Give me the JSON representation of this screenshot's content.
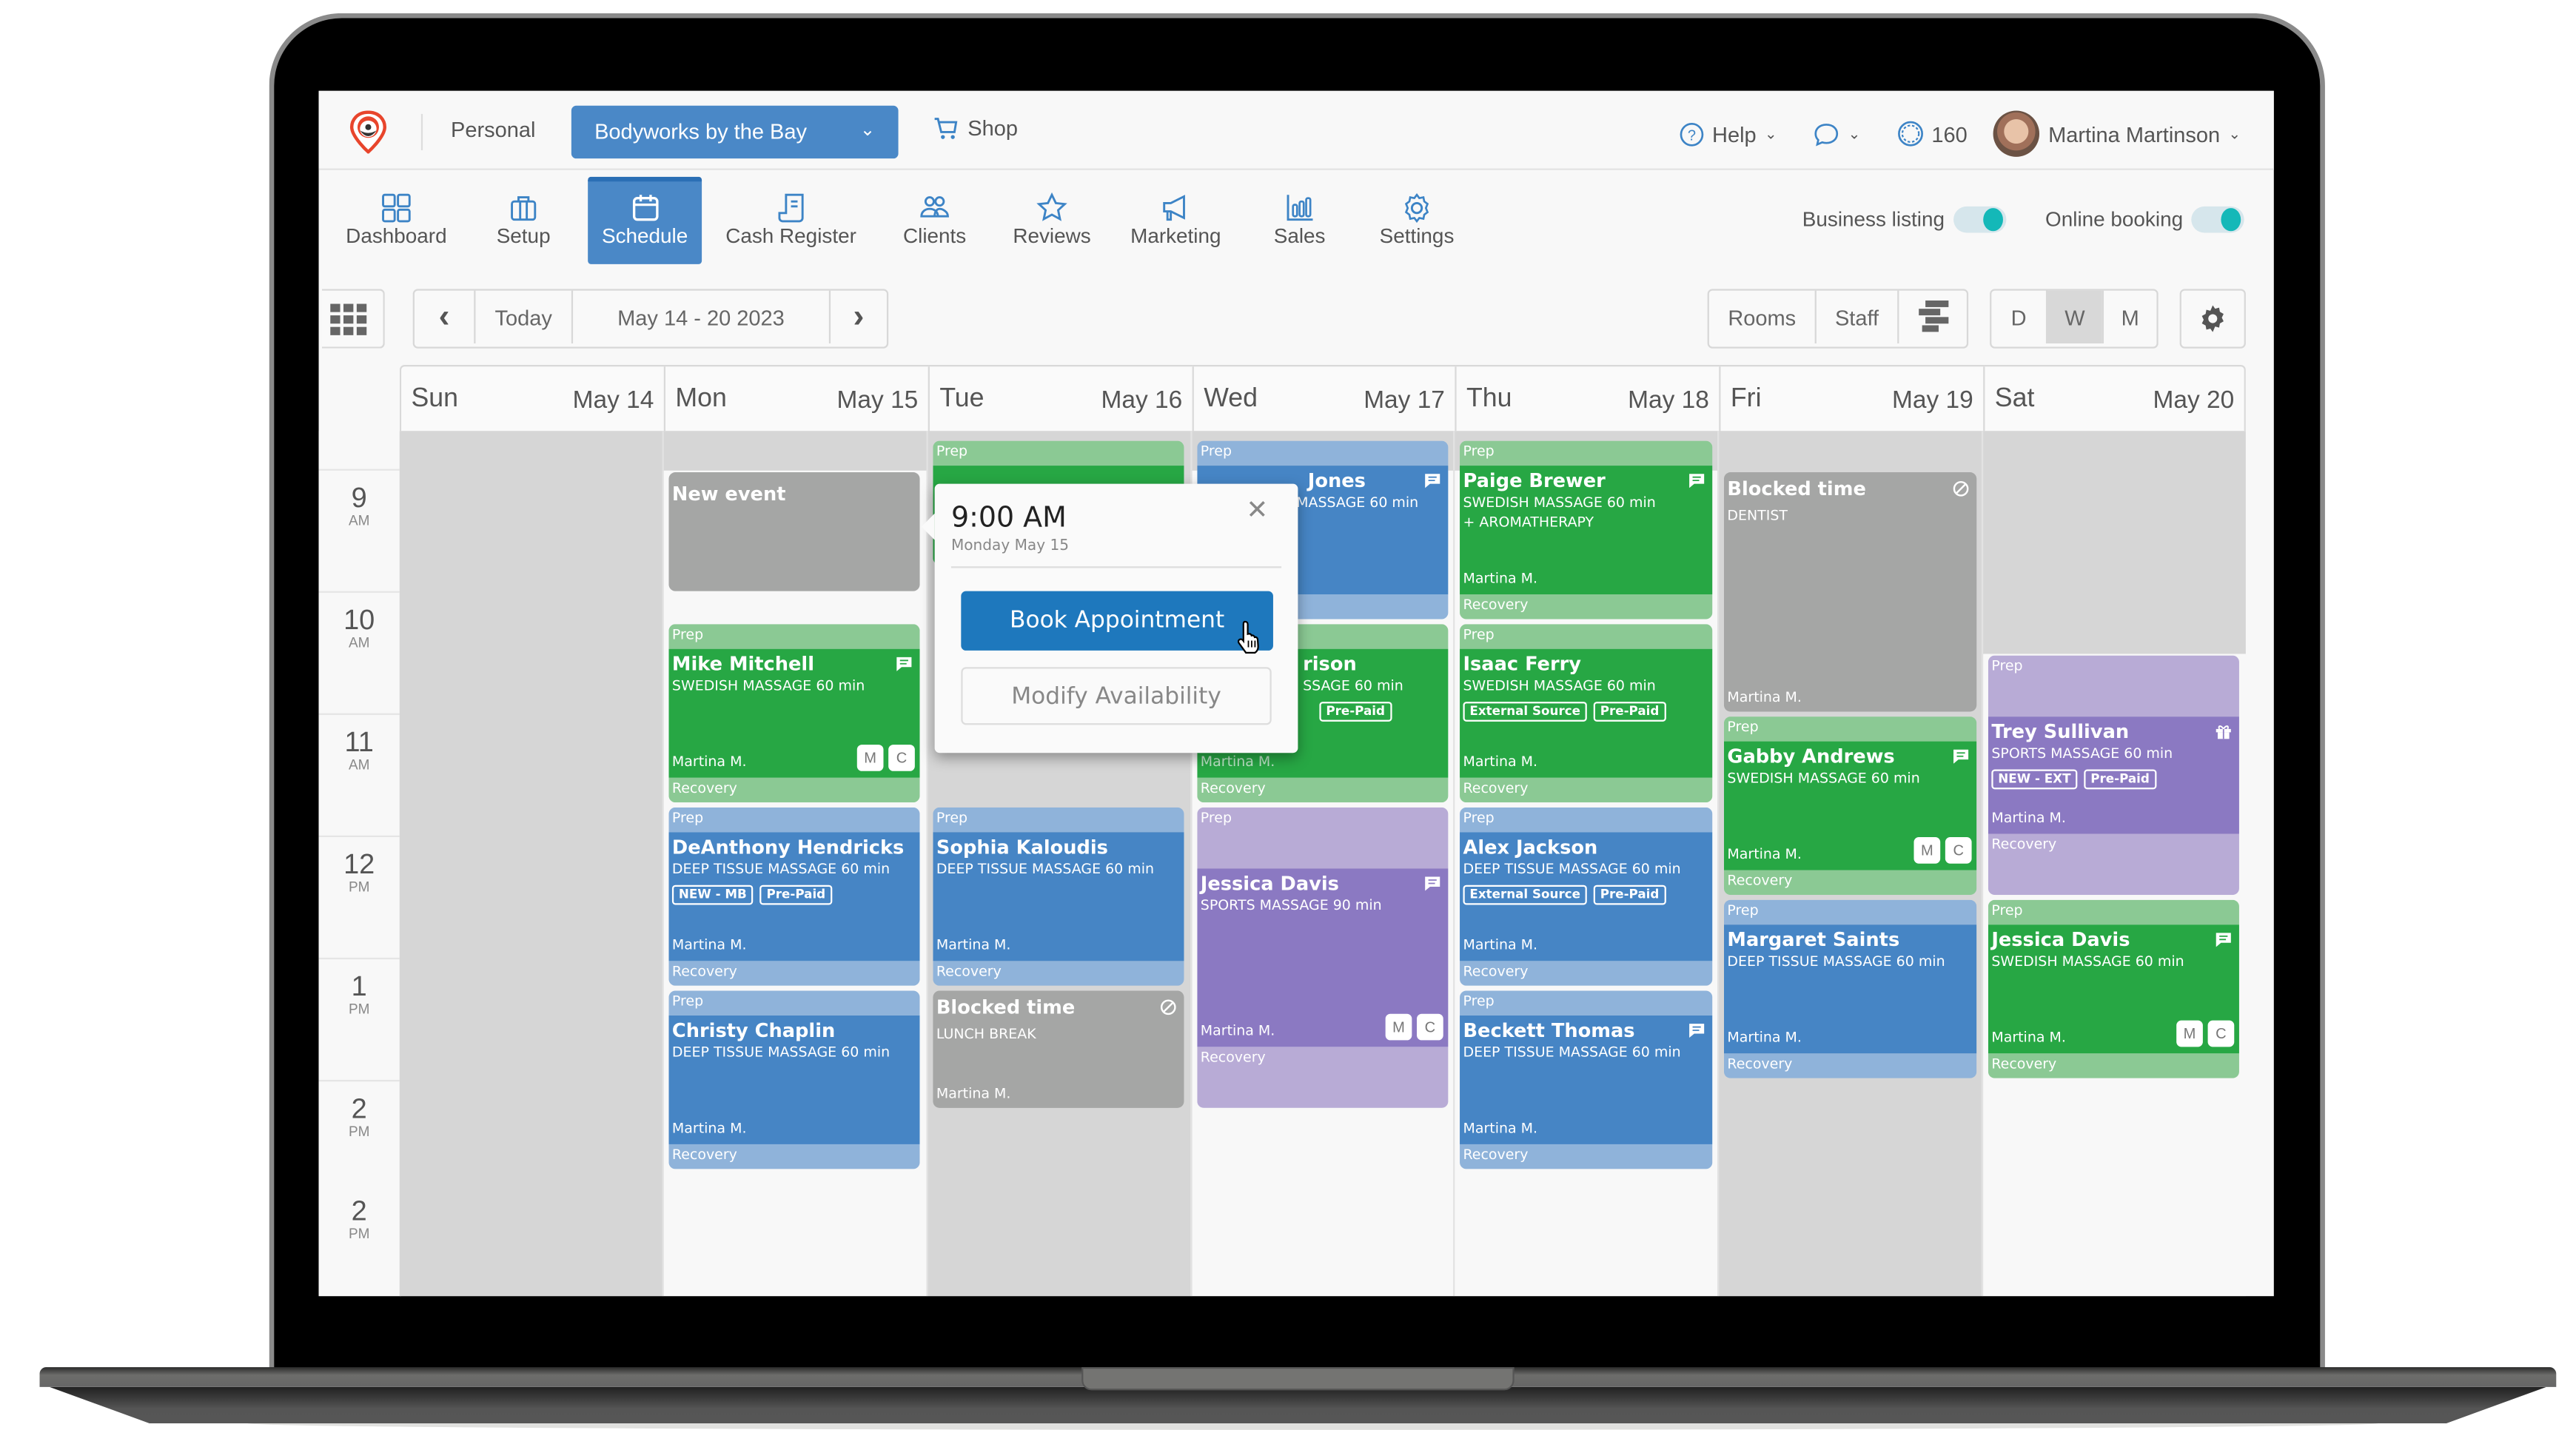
{
  "header": {
    "personal_label": "Personal",
    "business_select": "Bodyworks by the Bay",
    "shop_label": "Shop",
    "help_label": "Help",
    "credits_count": "160",
    "user_name": "Martina Martinson"
  },
  "nav": {
    "items": [
      {
        "label": "Dashboard",
        "icon": "dashboard-icon"
      },
      {
        "label": "Setup",
        "icon": "briefcase-icon"
      },
      {
        "label": "Schedule",
        "icon": "calendar-icon",
        "active": true
      },
      {
        "label": "Cash Register",
        "icon": "receipt-icon"
      },
      {
        "label": "Clients",
        "icon": "users-icon"
      },
      {
        "label": "Reviews",
        "icon": "star-icon"
      },
      {
        "label": "Marketing",
        "icon": "megaphone-icon"
      },
      {
        "label": "Sales",
        "icon": "bar-chart-icon"
      },
      {
        "label": "Settings",
        "icon": "gear-icon"
      }
    ],
    "toggles": [
      {
        "label": "Business listing",
        "on": true
      },
      {
        "label": "Online booking",
        "on": true
      }
    ]
  },
  "toolbar": {
    "today_label": "Today",
    "date_range": "May 14 - 20 2023",
    "rooms_label": "Rooms",
    "staff_label": "Staff",
    "view_d": "D",
    "view_w": "W",
    "view_m": "M",
    "selected_view": "W"
  },
  "days": [
    {
      "name": "Sun",
      "date": "May 14"
    },
    {
      "name": "Mon",
      "date": "May 15"
    },
    {
      "name": "Tue",
      "date": "May 16"
    },
    {
      "name": "Wed",
      "date": "May 17"
    },
    {
      "name": "Thu",
      "date": "May 18"
    },
    {
      "name": "Fri",
      "date": "May 19"
    },
    {
      "name": "Sat",
      "date": "May 20"
    }
  ],
  "times": [
    {
      "h": "9",
      "ap": "AM"
    },
    {
      "h": "10",
      "ap": "AM"
    },
    {
      "h": "11",
      "ap": "AM"
    },
    {
      "h": "12",
      "ap": "PM"
    },
    {
      "h": "1",
      "ap": "PM"
    },
    {
      "h": "2",
      "ap": "PM"
    },
    {
      "h": "2",
      "ap": "PM"
    }
  ],
  "labels": {
    "prep": "Prep",
    "recovery": "Recovery",
    "new_event": "New event",
    "blocked_time": "Blocked time"
  },
  "events": {
    "mon_mike": {
      "name": "Mike Mitchell",
      "service": "SWEDISH MASSAGE  60 min",
      "staff": "Martina M."
    },
    "mon_deanthony": {
      "name": "DeAnthony Hendricks",
      "service": "DEEP TISSUE MASSAGE  60 min",
      "tags": [
        "NEW - MB",
        "Pre-Paid"
      ],
      "staff": "Martina M."
    },
    "mon_christy": {
      "name": "Christy Chaplin",
      "service": "DEEP TISSUE MASSAGE  60 min",
      "staff": "Martina M."
    },
    "tue_sophia": {
      "name": "Sophia Kaloudis",
      "service": "DEEP TISSUE MASSAGE  60 min",
      "staff": "Martina M."
    },
    "tue_blocked": {
      "note": "LUNCH BREAK",
      "staff": "Martina M."
    },
    "wed_jones": {
      "name": "Jones",
      "service": "MASSAGE  60 min"
    },
    "wed_rison": {
      "name": "rison",
      "service": "SSAGE  60 min",
      "tags": [
        "Pre-Paid"
      ],
      "staff": "Martina M."
    },
    "wed_jessica": {
      "name": "Jessica Davis",
      "service": "SPORTS MASSAGE  90 min",
      "staff": "Martina M."
    },
    "thu_paige": {
      "name": "Paige Brewer",
      "service": "SWEDISH MASSAGE  60 min",
      "addon": "+  AROMATHERAPY",
      "staff": "Martina M."
    },
    "thu_isaac": {
      "name": "Isaac Ferry",
      "service": "SWEDISH MASSAGE  60 min",
      "tags": [
        "External Source",
        "Pre-Paid"
      ],
      "staff": "Martina M."
    },
    "thu_alex": {
      "name": "Alex Jackson",
      "service": "DEEP TISSUE MASSAGE  60 min",
      "tags": [
        "External Source",
        "Pre-Paid"
      ],
      "staff": "Martina M."
    },
    "thu_beckett": {
      "name": "Beckett Thomas",
      "service": "DEEP TISSUE MASSAGE  60 min",
      "staff": "Martina M."
    },
    "fri_blocked": {
      "note": "DENTIST",
      "staff": "Martina M."
    },
    "fri_gabby": {
      "name": "Gabby Andrews",
      "service": "SWEDISH MASSAGE  60 min",
      "staff": "Martina M."
    },
    "fri_margaret": {
      "name": "Margaret Saints",
      "service": "DEEP TISSUE MASSAGE  60 min",
      "staff": "Martina M."
    },
    "sat_trey": {
      "name": "Trey Sullivan",
      "service": "SPORTS MASSAGE  60 min",
      "tags": [
        "NEW - EXT",
        "Pre-Paid"
      ],
      "staff": "Martina M."
    },
    "sat_jessica": {
      "name": "Jessica Davis",
      "service": "SWEDISH MASSAGE  60 min",
      "staff": "Martina M."
    }
  },
  "mc": {
    "m": "M",
    "c": "C"
  },
  "popover": {
    "time": "9:00 AM",
    "date": "Monday May 15",
    "book_label": "Book Appointment",
    "modify_label": "Modify Availability"
  },
  "colors": {
    "primary": "#4a88c7",
    "book_button": "#1e78bd",
    "swedish": "#27a744",
    "deep_tissue": "#4685c5",
    "sports": "#8b79c2",
    "blocked": "#a5a6a5",
    "toggle_on": "#14b8b8"
  }
}
